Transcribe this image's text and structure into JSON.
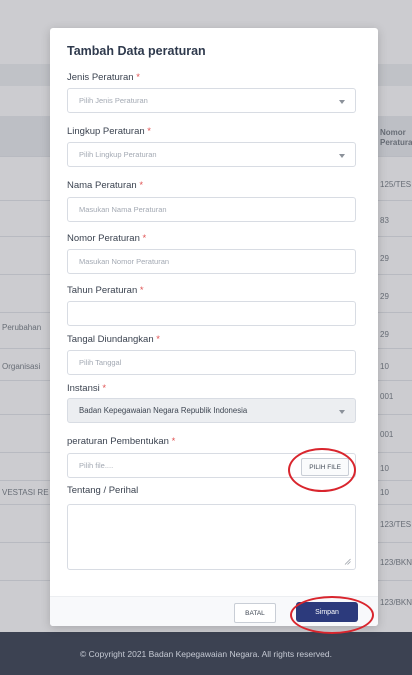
{
  "background": {
    "right_header": "Nomor\nPeraturan",
    "right_cells": [
      "125/TES",
      "83",
      "29",
      "29",
      "29",
      "10",
      "001",
      "001",
      "10",
      "10",
      "123/TES",
      "123/BKN",
      "123/BKN"
    ],
    "left_cells": [
      "Perubahan",
      "Organisasi",
      "VESTASI RE"
    ]
  },
  "modal": {
    "title": "Tambah Data peraturan",
    "required_mark": "*",
    "fields": {
      "jenis": {
        "label": "Jenis Peraturan",
        "placeholder": "Pilih Jenis Peraturan"
      },
      "lingkup": {
        "label": "Lingkup Peraturan",
        "placeholder": "Pilih Lingkup Peraturan"
      },
      "nama": {
        "label": "Nama Peraturan",
        "placeholder": "Masukan Nama Peraturan"
      },
      "nomor": {
        "label": "Nomor Peraturan",
        "placeholder": "Masukan Nomor Peraturan"
      },
      "tahun": {
        "label": "Tahun Peraturan",
        "value": ""
      },
      "tanggal": {
        "label": "Tangal Diundangkan",
        "placeholder": "Pilih Tanggal"
      },
      "instansi": {
        "label": "Instansi",
        "value": "Badan Kepegawaian Negara Republik Indonesia"
      },
      "pembentukan": {
        "label": "peraturan Pembentukan",
        "placeholder": "Pilih file....",
        "button": "PILIH FILE"
      },
      "tentang": {
        "label": "Tentang / Perihal",
        "value": ""
      }
    },
    "buttons": {
      "cancel": "BATAL",
      "save": "Simpan"
    }
  },
  "footer": {
    "text": "© Copyright 2021 Badan Kepegawaian Negara. All rights reserved."
  },
  "colors": {
    "primary": "#2c3a7c",
    "required": "#e05252",
    "annotation": "#d9252d",
    "footer_bg": "#3c4252"
  }
}
